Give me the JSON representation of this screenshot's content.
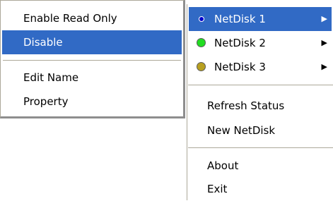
{
  "submenu": {
    "items": [
      {
        "label": "Enable Read Only"
      },
      {
        "label": "Disable"
      },
      {
        "label": "Edit Name"
      },
      {
        "label": "Property"
      }
    ]
  },
  "main_menu": {
    "netdisks": [
      {
        "label": "NetDisk 1",
        "status_color": "#0000cc",
        "selected": true
      },
      {
        "label": "NetDisk 2",
        "status_color": "#22dd22",
        "selected": false
      },
      {
        "label": "NetDisk 3",
        "status_color": "#b8a020",
        "selected": false
      }
    ],
    "refresh_label": "Refresh Status",
    "new_label": "New NetDisk",
    "about_label": "About",
    "exit_label": "Exit"
  },
  "colors": {
    "selection": "#316ac5"
  },
  "icons": {
    "status": "status-dot-icon",
    "submenu_arrow": "submenu-arrow-icon"
  }
}
